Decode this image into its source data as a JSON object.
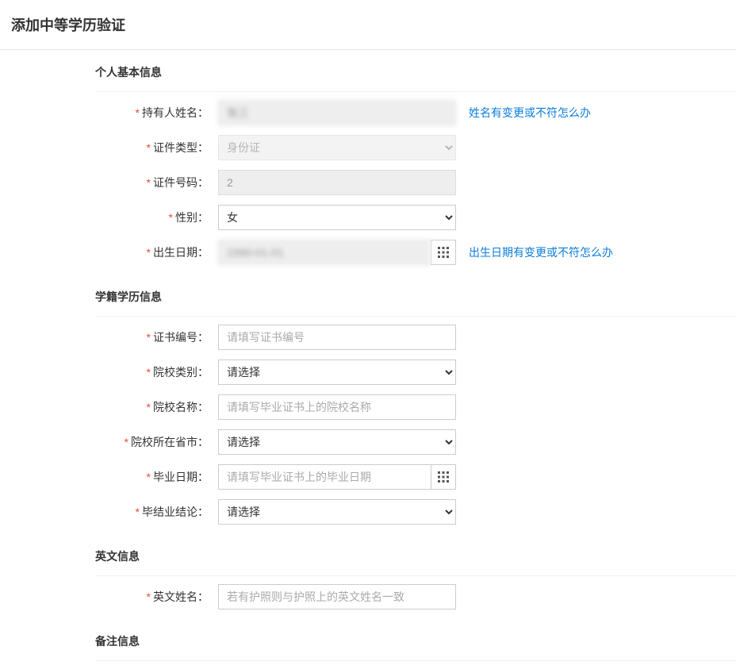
{
  "page": {
    "title": "添加中等学历验证"
  },
  "sections": {
    "personal": {
      "title": "个人基本信息",
      "fields": {
        "holder_name": {
          "label": "持有人姓名：",
          "value": "张三",
          "help_link": "姓名有变更或不符怎么办"
        },
        "id_type": {
          "label": "证件类型：",
          "value": "身份证"
        },
        "id_number": {
          "label": "证件号码：",
          "value": "2"
        },
        "gender": {
          "label": "性别：",
          "value": "女"
        },
        "birth_date": {
          "label": "出生日期：",
          "value": "1990-01-01",
          "help_link": "出生日期有变更或不符怎么办"
        }
      }
    },
    "education": {
      "title": "学籍学历信息",
      "fields": {
        "cert_number": {
          "label": "证书编号：",
          "placeholder": "请填写证书编号"
        },
        "school_type": {
          "label": "院校类别：",
          "placeholder": "请选择"
        },
        "school_name": {
          "label": "院校名称：",
          "placeholder": "请填写毕业证书上的院校名称"
        },
        "school_province": {
          "label": "院校所在省市：",
          "placeholder": "请选择"
        },
        "graduation_date": {
          "label": "毕业日期：",
          "placeholder": "请填写毕业证书上的毕业日期"
        },
        "graduation_conclusion": {
          "label": "毕结业结论：",
          "placeholder": "请选择"
        }
      }
    },
    "english": {
      "title": "英文信息",
      "fields": {
        "english_name": {
          "label": "英文姓名：",
          "placeholder": "若有护照则与护照上的英文姓名一致"
        }
      }
    },
    "remarks": {
      "title": "备注信息"
    }
  }
}
